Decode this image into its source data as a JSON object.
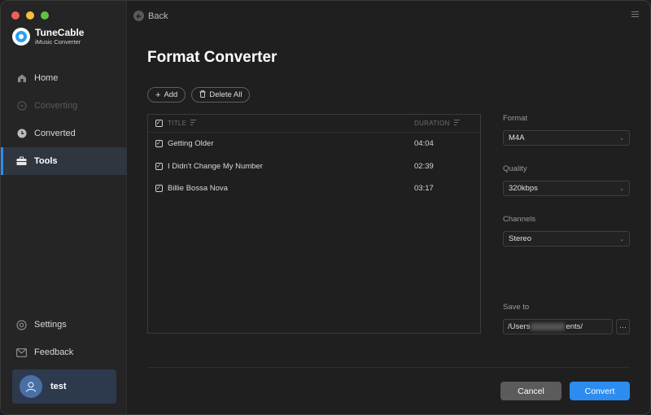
{
  "app": {
    "name": "TuneCable",
    "subtitle": "iMusic Converter"
  },
  "sidebar": {
    "items": [
      {
        "label": "Home",
        "icon": "home-icon",
        "state": "normal"
      },
      {
        "label": "Converting",
        "icon": "converting-icon",
        "state": "disabled"
      },
      {
        "label": "Converted",
        "icon": "clock-icon",
        "state": "normal"
      },
      {
        "label": "Tools",
        "icon": "toolbox-icon",
        "state": "active"
      }
    ],
    "bottom_items": [
      {
        "label": "Settings",
        "icon": "gear-icon"
      },
      {
        "label": "Feedback",
        "icon": "mail-icon"
      }
    ],
    "user": {
      "name": "test"
    }
  },
  "header": {
    "back_label": "Back"
  },
  "page": {
    "title": "Format Converter"
  },
  "toolbar": {
    "add_label": "Add",
    "delete_all_label": "Delete All"
  },
  "table": {
    "columns": {
      "title": "TITLE",
      "duration": "DURATION"
    },
    "rows": [
      {
        "title": "Getting Older",
        "duration": "04:04"
      },
      {
        "title": "I Didn't Change My Number",
        "duration": "02:39"
      },
      {
        "title": "Billie Bossa Nova",
        "duration": "03:17"
      }
    ]
  },
  "settings": {
    "format": {
      "label": "Format",
      "value": "M4A"
    },
    "quality": {
      "label": "Quality",
      "value": "320kbps"
    },
    "channels": {
      "label": "Channels",
      "value": "Stereo"
    },
    "save_to": {
      "label": "Save to",
      "path_start": "/Users",
      "path_end": "ents/",
      "browse_label": "···"
    }
  },
  "actions": {
    "cancel_label": "Cancel",
    "convert_label": "Convert"
  },
  "colors": {
    "accent": "#2d8cf0",
    "background": "#1f1f1f",
    "sidebar": "#252525"
  }
}
